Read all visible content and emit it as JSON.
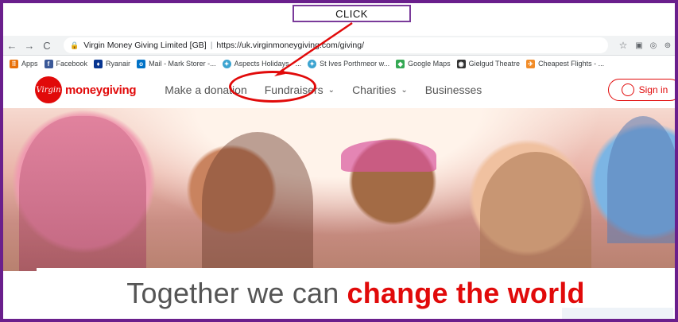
{
  "annotation": {
    "label": "CLICK"
  },
  "browser": {
    "back": "←",
    "forward": "→",
    "reload": "C",
    "site_name": "Virgin Money Giving Limited [GB]",
    "url": "https://uk.virginmoneygiving.com/giving/",
    "bookmarks": [
      {
        "label": "Apps",
        "icon": "apps-grid-icon",
        "color": "#e8710a"
      },
      {
        "label": "Facebook",
        "icon": "facebook-icon",
        "color": "#3b5998"
      },
      {
        "label": "Ryanair",
        "icon": "ryanair-icon",
        "color": "#073590"
      },
      {
        "label": "Mail - Mark Storer -...",
        "icon": "outlook-icon",
        "color": "#0072c6"
      },
      {
        "label": "Aspects Holidays - ...",
        "icon": "aspects-icon",
        "color": "#3ba3d0"
      },
      {
        "label": "St Ives Porthmeor w...",
        "icon": "stives-icon",
        "color": "#3ba3d0"
      },
      {
        "label": "Google Maps",
        "icon": "google-maps-icon",
        "color": "#34a853"
      },
      {
        "label": "Gielgud Theatre",
        "icon": "theatre-icon",
        "color": "#333333"
      },
      {
        "label": "Cheapest Flights - ...",
        "icon": "plane-icon",
        "color": "#f28c28"
      }
    ]
  },
  "site": {
    "logo_badge": "Virgin",
    "logo_text": "moneygiving",
    "nav": [
      {
        "label": "Make a donation",
        "has_dropdown": false
      },
      {
        "label": "Fundraisers",
        "has_dropdown": true
      },
      {
        "label": "Charities",
        "has_dropdown": true
      },
      {
        "label": "Businesses",
        "has_dropdown": false
      }
    ],
    "signin": "Sign in",
    "tagline_prefix": "Together we can",
    "tagline_accent": "change the world",
    "accent_color": "#e10a0a"
  }
}
